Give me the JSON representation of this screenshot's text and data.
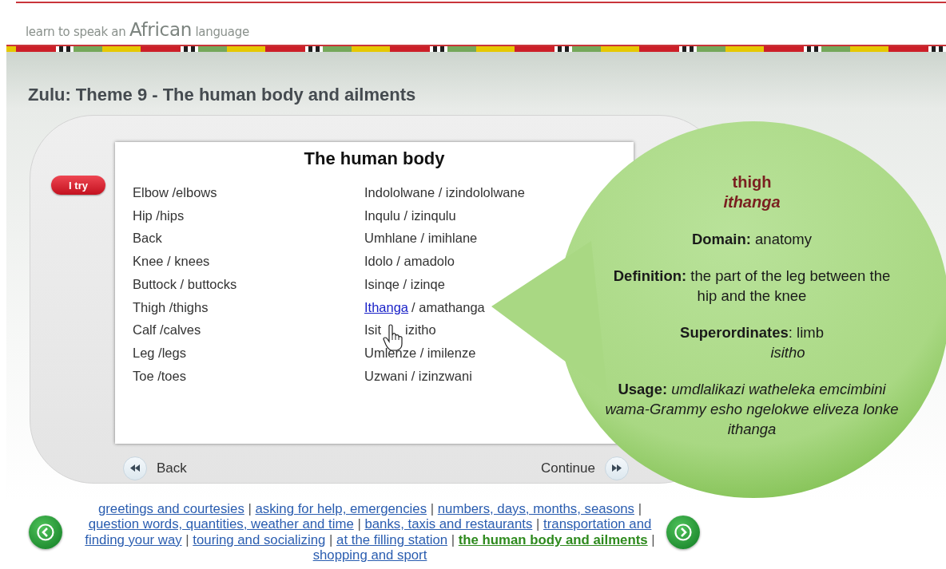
{
  "site": {
    "tagline_pre": "learn to speak an",
    "tagline_main": "African",
    "tagline_post": "language"
  },
  "page_title": "Zulu: Theme 9 - The human body and ailments",
  "lesson": {
    "try_button": "I try",
    "card_title": "The human body",
    "rows": [
      {
        "english": "Elbow /elbows",
        "zulu": [
          {
            "kind": "text",
            "text": "Indololwane / izindololwane"
          }
        ]
      },
      {
        "english": "Hip /hips",
        "zulu": [
          {
            "kind": "text",
            "text": "Inqulu / izinqulu"
          }
        ]
      },
      {
        "english": "Back",
        "zulu": [
          {
            "kind": "text",
            "text": "Umhlane / imihlane"
          }
        ]
      },
      {
        "english": "Knee / knees",
        "zulu": [
          {
            "kind": "text",
            "text": "Idolo / amadolo"
          }
        ]
      },
      {
        "english": "Buttock / buttocks",
        "zulu": [
          {
            "kind": "text",
            "text": "Isinqe / izinqe"
          }
        ]
      },
      {
        "english": "Thigh /thighs",
        "zulu": [
          {
            "kind": "link",
            "text": "Ithanga"
          },
          {
            "kind": "text",
            "text": "/ amathanga"
          }
        ]
      },
      {
        "english": "Calf /calves",
        "zulu": [
          {
            "kind": "text",
            "text": "Isit"
          },
          {
            "kind": "covered"
          },
          {
            "kind": "text",
            "text": "izitho"
          }
        ]
      },
      {
        "english": "Leg /legs",
        "zulu": [
          {
            "kind": "text",
            "text": "Umlenze / imilenze"
          }
        ]
      },
      {
        "english": "Toe /toes",
        "zulu": [
          {
            "kind": "text",
            "text": "Uzwani / izinzwani"
          }
        ]
      }
    ],
    "back": "Back",
    "continue": "Continue"
  },
  "bubble": {
    "headword": "thigh",
    "translation": "ithanga",
    "fields": [
      {
        "kind": "plain",
        "label": "Domain:",
        "text": "anatomy"
      },
      {
        "kind": "plain",
        "label": "Definition:",
        "text": "the part of the leg between the hip and the knee"
      },
      {
        "kind": "plain",
        "label": "Superordinates",
        "text": ": limb",
        "translation": "isitho"
      },
      {
        "kind": "italic",
        "label": "Usage:",
        "text": "umdlalikazi watheleka emcimbini wama-Grammy esho ngelokwe eliveza lonke ithanga"
      }
    ]
  },
  "topics": {
    "lines": [
      [
        {
          "kind": "link",
          "label": "greetings and courtesies",
          "selected": false
        },
        {
          "kind": "separator",
          "label": "|"
        },
        {
          "kind": "link",
          "label": "asking for help, emergencies",
          "selected": false
        },
        {
          "kind": "separator",
          "label": "|"
        },
        {
          "kind": "link",
          "label": "numbers, days, months, seasons",
          "selected": false
        },
        {
          "kind": "separator",
          "label": "|"
        }
      ],
      [
        {
          "kind": "link",
          "label": "question words, quantities, weather and time",
          "selected": false
        },
        {
          "kind": "separator",
          "label": "|"
        },
        {
          "kind": "link",
          "label": "banks, taxis and restaurants",
          "selected": false
        },
        {
          "kind": "separator",
          "label": "|"
        },
        {
          "kind": "link",
          "label": "transportation and",
          "selected": false
        }
      ],
      [
        {
          "kind": "link",
          "label": "finding your way",
          "selected": false
        },
        {
          "kind": "separator",
          "label": "|"
        },
        {
          "kind": "link",
          "label": "touring and socializing",
          "selected": false
        },
        {
          "kind": "separator",
          "label": "|"
        },
        {
          "kind": "link",
          "label": "at the filling station",
          "selected": false
        },
        {
          "kind": "separator",
          "label": "|"
        },
        {
          "kind": "link",
          "label": "the human body and ailments",
          "selected": true
        },
        {
          "kind": "separator",
          "label": "|"
        }
      ],
      [
        {
          "kind": "link",
          "label": "shopping and sport",
          "selected": false
        }
      ]
    ]
  }
}
